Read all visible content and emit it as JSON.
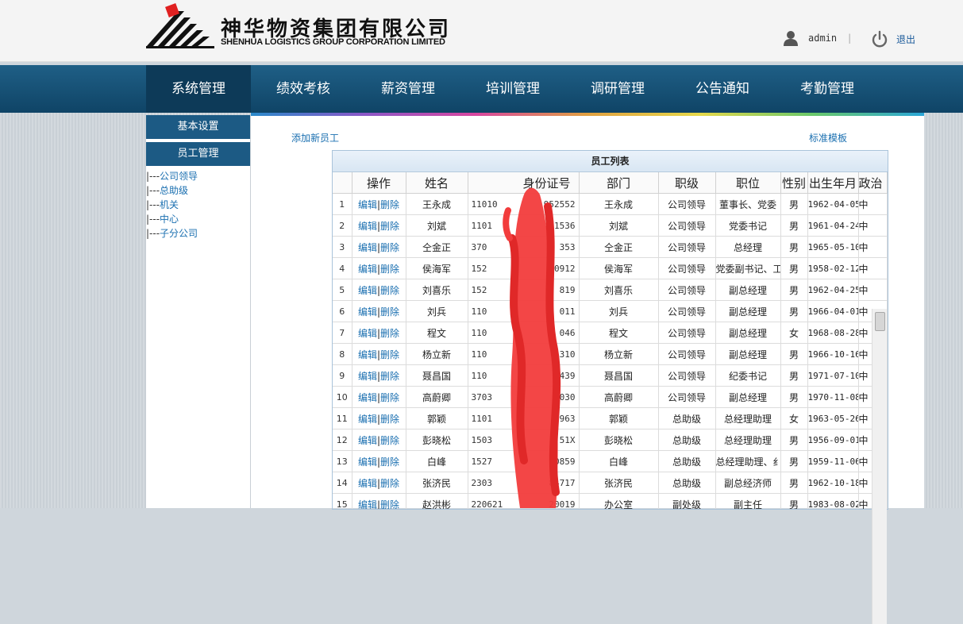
{
  "header": {
    "company_cn": "神华物资集团有限公司",
    "company_en": "SHENHUA LOGISTICS GROUP CORPORATION LIMITED",
    "username": "admin",
    "separator": "|",
    "logout_label": "退出"
  },
  "nav": {
    "items": [
      {
        "label": "系统管理",
        "active": true
      },
      {
        "label": "绩效考核"
      },
      {
        "label": "薪资管理"
      },
      {
        "label": "培训管理"
      },
      {
        "label": "调研管理"
      },
      {
        "label": "公告通知"
      },
      {
        "label": "考勤管理"
      }
    ]
  },
  "sidebar": {
    "buttons": [
      "基本设置",
      "员工管理"
    ],
    "tree_prefix": "|---",
    "tree": [
      "公司领导",
      "总助级",
      "机关",
      "中心",
      "子分公司"
    ]
  },
  "main": {
    "add_link": "添加新员工",
    "template_link": "标准模板",
    "table_title": "员工列表",
    "edit_label": "编辑",
    "delete_label": "删除",
    "columns": [
      "操作",
      "姓名",
      "身份证号",
      "部门",
      "职级",
      "职位",
      "性别",
      "出生年月",
      "政治"
    ],
    "rows": [
      {
        "no": "1",
        "name": "王永成",
        "id_head": "11010",
        "id_tail": "952552",
        "dept": "王永成",
        "level": "公司领导",
        "position": "董事长、党委",
        "gender": "男",
        "birth": "1962-04-05",
        "pol": "中"
      },
      {
        "no": "2",
        "name": "刘斌",
        "id_head": "1101",
        "id_tail": "1536",
        "dept": "刘斌",
        "level": "公司领导",
        "position": "党委书记",
        "gender": "男",
        "birth": "1961-04-24",
        "pol": "中"
      },
      {
        "no": "3",
        "name": "仝金正",
        "id_head": "370",
        "id_tail": "353",
        "dept": "仝金正",
        "level": "公司领导",
        "position": "总经理",
        "gender": "男",
        "birth": "1965-05-10",
        "pol": "中"
      },
      {
        "no": "4",
        "name": "侯海军",
        "id_head": "152",
        "id_tail": "0912",
        "dept": "侯海军",
        "level": "公司领导",
        "position": "党委副书记、工",
        "gender": "男",
        "birth": "1958-02-12",
        "pol": "中"
      },
      {
        "no": "5",
        "name": "刘喜乐",
        "id_head": "152",
        "id_tail": "819",
        "dept": "刘喜乐",
        "level": "公司领导",
        "position": "副总经理",
        "gender": "男",
        "birth": "1962-04-25",
        "pol": "中"
      },
      {
        "no": "6",
        "name": "刘兵",
        "id_head": "110",
        "id_tail": "011",
        "dept": "刘兵",
        "level": "公司领导",
        "position": "副总经理",
        "gender": "男",
        "birth": "1966-04-01",
        "pol": "中"
      },
      {
        "no": "7",
        "name": "程文",
        "id_head": "110",
        "id_tail": "046",
        "dept": "程文",
        "level": "公司领导",
        "position": "副总经理",
        "gender": "女",
        "birth": "1968-08-28",
        "pol": "中"
      },
      {
        "no": "8",
        "name": "杨立新",
        "id_head": "110",
        "id_tail": "310",
        "dept": "杨立新",
        "level": "公司领导",
        "position": "副总经理",
        "gender": "男",
        "birth": "1966-10-16",
        "pol": "中"
      },
      {
        "no": "9",
        "name": "聂昌国",
        "id_head": "110",
        "id_tail": "439",
        "dept": "聂昌国",
        "level": "公司领导",
        "position": "纪委书记",
        "gender": "男",
        "birth": "1971-07-10",
        "pol": "中"
      },
      {
        "no": "10",
        "name": "高蔚卿",
        "id_head": "3703",
        "id_tail": "030",
        "dept": "高蔚卿",
        "level": "公司领导",
        "position": "副总经理",
        "gender": "男",
        "birth": "1970-11-08",
        "pol": "中"
      },
      {
        "no": "11",
        "name": "郭颖",
        "id_head": "1101",
        "id_tail": "963",
        "dept": "郭颖",
        "level": "总助级",
        "position": "总经理助理",
        "gender": "女",
        "birth": "1963-05-26",
        "pol": "中"
      },
      {
        "no": "12",
        "name": "彭晓松",
        "id_head": "1503",
        "id_tail": "51X",
        "dept": "彭晓松",
        "level": "总助级",
        "position": "总经理助理",
        "gender": "男",
        "birth": "1956-09-01",
        "pol": "中"
      },
      {
        "no": "13",
        "name": "白峰",
        "id_head": "1527",
        "id_tail": "0859",
        "dept": "白峰",
        "level": "总助级",
        "position": "总经理助理、纟",
        "gender": "男",
        "birth": "1959-11-06",
        "pol": "中"
      },
      {
        "no": "14",
        "name": "张济民",
        "id_head": "2303",
        "id_tail": "84717",
        "dept": "张济民",
        "level": "总助级",
        "position": "副总经济师",
        "gender": "男",
        "birth": "1962-10-18",
        "pol": "中"
      },
      {
        "no": "15",
        "name": "赵洪彬",
        "id_head": "220621",
        "id_tail": "20019",
        "dept": "办公室",
        "level": "副处级",
        "position": "副主任",
        "gender": "男",
        "birth": "1983-08-02",
        "pol": "中"
      }
    ]
  },
  "colors": {
    "nav_bg": "#1b5780",
    "nav_active": "#0d3a58",
    "link": "#1a6fb0",
    "redaction": "#f23c3c"
  }
}
